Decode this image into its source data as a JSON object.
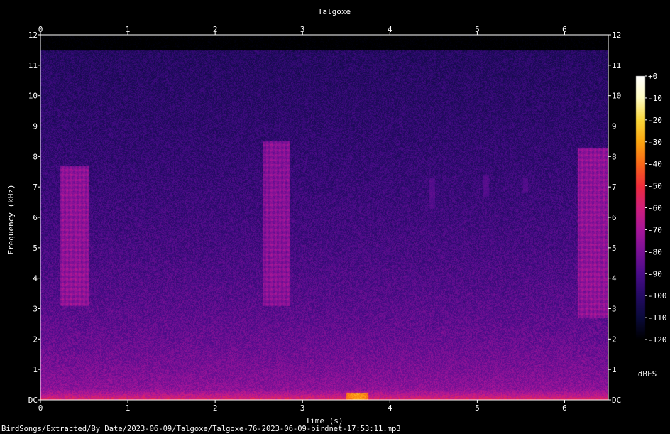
{
  "chart_data": {
    "type": "heatmap",
    "title": "Talgoxe",
    "xlabel": "Time (s)",
    "ylabel": "Frequency (kHz)",
    "xlim": [
      0,
      6.5
    ],
    "ylim": [
      0,
      12
    ],
    "x_ticks": [
      "0",
      "1",
      "2",
      "3",
      "4",
      "5",
      "6"
    ],
    "y_ticks": [
      "DC",
      "1",
      "2",
      "3",
      "4",
      "5",
      "6",
      "7",
      "8",
      "9",
      "10",
      "11",
      "12"
    ],
    "colorbar": {
      "unit": "dBFS",
      "range": [
        -120,
        0
      ],
      "ticks": [
        "+0",
        "-10",
        "-20",
        "-30",
        "-40",
        "-50",
        "-60",
        "-70",
        "-80",
        "-90",
        "-100",
        "-110",
        "-120"
      ],
      "colors": [
        "#000000",
        "#0a0a3a",
        "#240a64",
        "#4a0c8a",
        "#7a1196",
        "#a8169a",
        "#d01f7c",
        "#ef2c3c",
        "#f9671a",
        "#fca510",
        "#f9d73a",
        "#fffcc0",
        "#ffffff"
      ]
    },
    "bird_call_bursts": [
      {
        "t_start": 0.22,
        "t_end": 0.55,
        "f_low_khz": 3.1,
        "f_high_khz": 7.7,
        "level_dbfs": -75
      },
      {
        "t_start": 2.55,
        "t_end": 2.85,
        "f_low_khz": 3.1,
        "f_high_khz": 8.5,
        "level_dbfs": -77
      },
      {
        "t_start": 6.15,
        "t_end": 6.5,
        "f_low_khz": 2.7,
        "f_high_khz": 8.3,
        "level_dbfs": -75
      }
    ],
    "faint_marks": [
      {
        "t": 4.48,
        "f_low_khz": 6.3,
        "f_high_khz": 7.3
      },
      {
        "t": 5.1,
        "f_low_khz": 6.7,
        "f_high_khz": 7.4
      },
      {
        "t": 5.55,
        "f_low_khz": 6.8,
        "f_high_khz": 7.3
      }
    ],
    "noise_floor": {
      "f_top_khz": 11.5,
      "level_low_freq_dbfs": -65,
      "level_high_freq_dbfs": -100
    },
    "hot_spot": {
      "t_start": 3.5,
      "t_end": 3.75,
      "f_khz": 0.1,
      "level_dbfs": -30
    }
  },
  "footer": {
    "path": "BirdSongs/Extracted/By_Date/2023-06-09/Talgoxe/Talgoxe-76-2023-06-09-birdnet-17:53:11.mp3"
  }
}
